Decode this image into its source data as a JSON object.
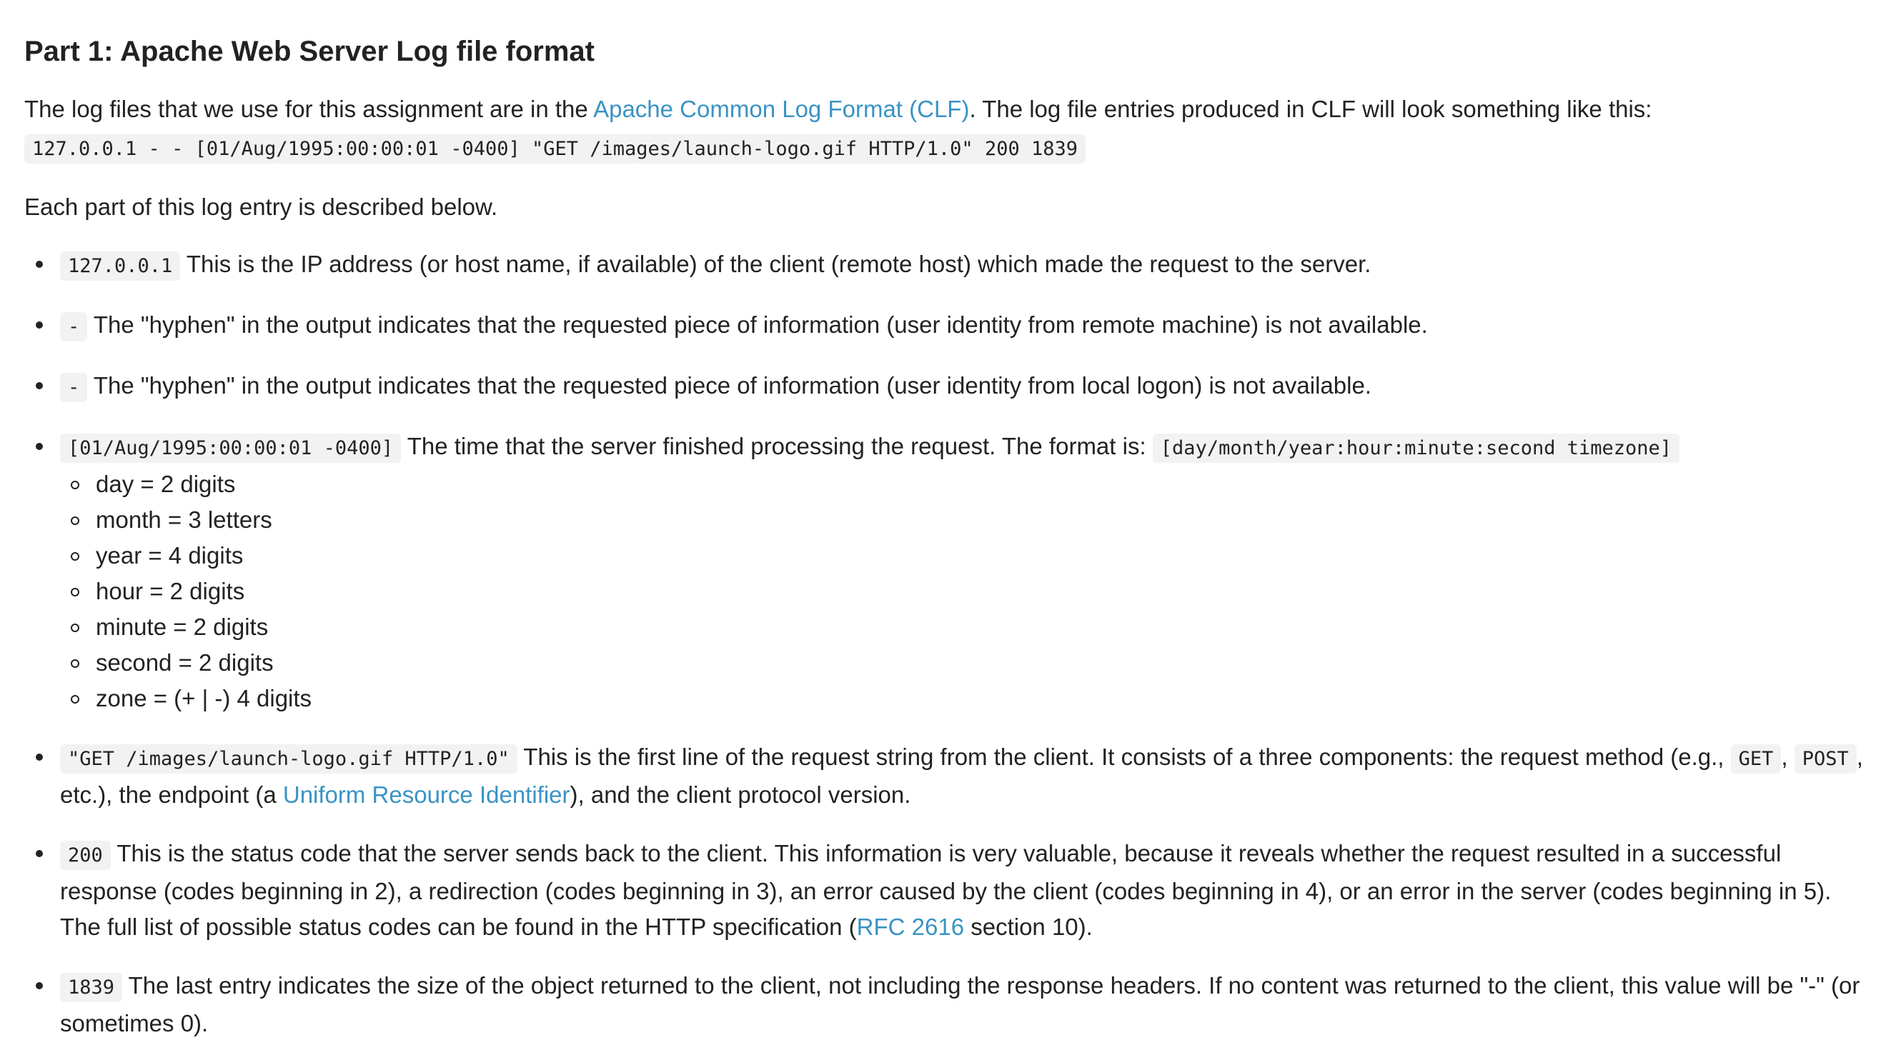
{
  "heading": "Part 1: Apache Web Server Log file format",
  "intro": {
    "before_link": "The log files that we use for this assignment are in the ",
    "link_text": "Apache Common Log Format (CLF)",
    "after_link": ". The log file entries produced in CLF will look something like this:"
  },
  "sample_line": "127.0.0.1 - - [01/Aug/1995:00:00:01 -0400] \"GET /images/launch-logo.gif HTTP/1.0\" 200 1839",
  "each_part_text": "Each part of this log entry is described below.",
  "entries": {
    "ip": {
      "code": "127.0.0.1",
      "text": " This is the IP address (or host name, if available) of the client (remote host) which made the request to the server."
    },
    "hyphen_remote": {
      "code": "-",
      "text": " The \"hyphen\" in the output indicates that the requested piece of information (user identity from remote machine) is not available."
    },
    "hyphen_local": {
      "code": "-",
      "text": " The \"hyphen\" in the output indicates that the requested piece of information (user identity from local logon) is not available."
    },
    "time": {
      "code": "[01/Aug/1995:00:00:01 -0400]",
      "text": " The time that the server finished processing the request. The format is: ",
      "format_code": "[day/month/year:hour:minute:second timezone]",
      "format_items": [
        "day = 2 digits",
        "month = 3 letters",
        "year = 4 digits",
        "hour = 2 digits",
        "minute = 2 digits",
        "second = 2 digits",
        "zone = (+ | -) 4 digits"
      ]
    },
    "request": {
      "code": "\"GET /images/launch-logo.gif HTTP/1.0\"",
      "text_1": " This is the first line of the request string from the client. It consists of a three components: the request method (e.g., ",
      "get_code": "GET",
      "comma": ", ",
      "post_code": "POST",
      "text_2": ", etc.), the endpoint (a ",
      "link_text": "Uniform Resource Identifier",
      "text_3": "), and the client protocol version."
    },
    "status": {
      "code": "200",
      "text_1": " This is the status code that the server sends back to the client. This information is very valuable, because it reveals whether the request resulted in a successful response (codes beginning in 2), a redirection (codes beginning in 3), an error caused by the client (codes beginning in 4), or an error in the server (codes beginning in 5). The full list of possible status codes can be found in the HTTP specification (",
      "link_text": "RFC 2616",
      "text_2": " section 10)."
    },
    "size": {
      "code": "1839",
      "text": " The last entry indicates the size of the object returned to the client, not including the response headers. If no content was returned to the client, this value will be \"-\" (or sometimes 0)."
    }
  },
  "colors": {
    "text": "#222222",
    "link": "#3a93c4",
    "code_background": "#f2f2f2",
    "page_background": "#ffffff"
  }
}
